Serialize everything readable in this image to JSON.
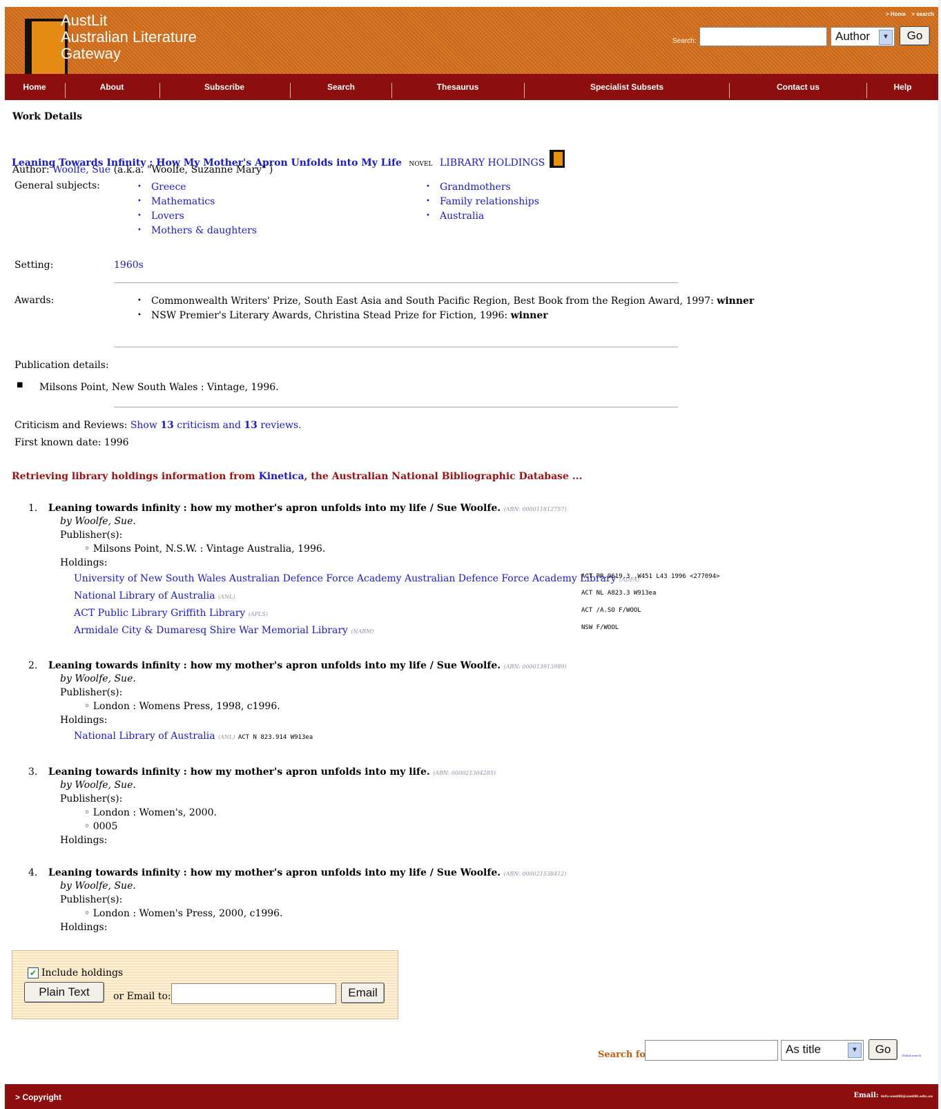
{
  "header": {
    "logo_line1": "AustLit",
    "logo_line2": "Australian Literature",
    "logo_line3": "Gateway",
    "top_links": [
      "> Home",
      "> search"
    ],
    "search_label": "Search:",
    "search_value": "",
    "search_select": "Author",
    "go_label": "Go"
  },
  "nav": [
    "Home",
    "About",
    "Subscribe",
    "Search",
    "Thesaurus",
    "Specialist Subsets",
    "Contact us",
    "Help"
  ],
  "work": {
    "section_title": "Work Details",
    "title": "Leaning Towards Infinity : How My Mother's Apron Unfolds into My Life",
    "form": "NOVEL",
    "holdings_link": "LIBRARY HOLDINGS",
    "author_label": "Author:",
    "author_name": "Woolfe, Sue",
    "author_aka": "(a.k.a. \"Woolfe, Suzanne Mary\" )",
    "subjects_label": "General subjects:",
    "subjects_col1": [
      "Greece",
      "Mathematics",
      "Lovers",
      "Mothers & daughters"
    ],
    "subjects_col2": [
      "Grandmothers",
      "Family relationships",
      "Australia"
    ],
    "setting_label": "Setting:",
    "setting_value": "1960s",
    "awards_label": "Awards:",
    "awards": [
      {
        "text": "Commonwealth Writers' Prize, South East Asia and South Pacific Region, Best Book from the Region Award, 1997:",
        "result": "winner"
      },
      {
        "text": "NSW Premier's Literary Awards, Christina Stead Prize for Fiction, 1996:",
        "result": "winner"
      }
    ],
    "pub_label": "Publication details:",
    "pub_value": "Milsons Point, New South Wales : Vintage, 1996.",
    "crit_label": "Criticism and Reviews:",
    "crit_link_pre": "Show",
    "crit_count": "13",
    "crit_mid": "criticism and",
    "rev_count": "13",
    "rev_post": "reviews.",
    "first_date_label": "First known date:",
    "first_date": "1996"
  },
  "retrieving": {
    "pre": "Retrieving library holdings information from",
    "link": "Kinetica",
    "post": ", the Australian National Bibliographic Database ..."
  },
  "records": [
    {
      "num": "1.",
      "title": "Leaning towards infinity : how my mother's apron unfolds into my life / Sue Woolfe.",
      "abn": "(ABN: 000011812757)",
      "by": "by Woolfe, Sue.",
      "pub_label": "Publisher(s):",
      "publishers": [
        "Milsons Point, N.S.W. : Vintage Australia, 1996."
      ],
      "holdings_label": "Holdings:",
      "holdings": [
        {
          "lib": "University of New South Wales Australian Defence Force Academy Australian Defence Force Academy Library",
          "code": "(ADFA)",
          "call": "ACT  PR.9619.3 .W451 L43 1996 <277094>"
        },
        {
          "lib": "National Library of Australia",
          "code": "(ANL)",
          "call": "ACT  NL A823.3 W913ea"
        },
        {
          "lib": "ACT Public Library Griffith Library",
          "code": "(APLS)",
          "call": "ACT  /A.SO F/WOOL"
        },
        {
          "lib": "Armidale City & Dumaresq Shire War Memorial Library",
          "code": "(NARM)",
          "call": "NSW  F/WOOL"
        }
      ]
    },
    {
      "num": "2.",
      "title": "Leaning towards infinity : how my mother's apron unfolds into my life / Sue Woolfe.",
      "abn": "(ABN: 000013913989)",
      "by": "by Woolfe, Sue.",
      "pub_label": "Publisher(s):",
      "publishers": [
        "London : Womens Press, 1998, c1996."
      ],
      "holdings_label": "Holdings:",
      "holdings": [
        {
          "lib": "National Library of Australia",
          "code": "(ANL)",
          "call": "ACT  N 823.914 W913ea"
        }
      ]
    },
    {
      "num": "3.",
      "title": "Leaning towards infinity : how my mother's apron unfolds into my life.",
      "abn": "(ABN: 000021304285)",
      "by": "by Woolfe, Sue.",
      "pub_label": "Publisher(s):",
      "publishers": [
        "London : Women's, 2000.",
        "0005"
      ],
      "holdings_label": "Holdings:",
      "holdings": []
    },
    {
      "num": "4.",
      "title": "Leaning towards infinity : how my mother's apron unfolds into my life / Sue Woolfe.",
      "abn": "(ABN: 000021538412)",
      "by": "by Woolfe, Sue.",
      "pub_label": "Publisher(s):",
      "publishers": [
        "London : Women's Press, 2000, c1996."
      ],
      "holdings_label": "Holdings:",
      "holdings": []
    }
  ],
  "export": {
    "include_label": "Include holdings",
    "plain_text": "Plain Text",
    "or_email": "or  Email to:",
    "email_value": "",
    "email_btn": "Email"
  },
  "bottom_search": {
    "label": "Search for:",
    "value": "",
    "select": "As title",
    "go": "Go",
    "small_link": "Global search"
  },
  "footer": {
    "copyright": "> Copyright",
    "email_label": "Email:",
    "email_value": "info-austlit@austlit.edu.au"
  },
  "colors": {
    "header_orange": "#d0701f",
    "nav_red": "#8c0e0e",
    "link_blue": "#1a1acc",
    "retrieving_red": "#9c1010",
    "search_for_orange": "#c85a10"
  }
}
